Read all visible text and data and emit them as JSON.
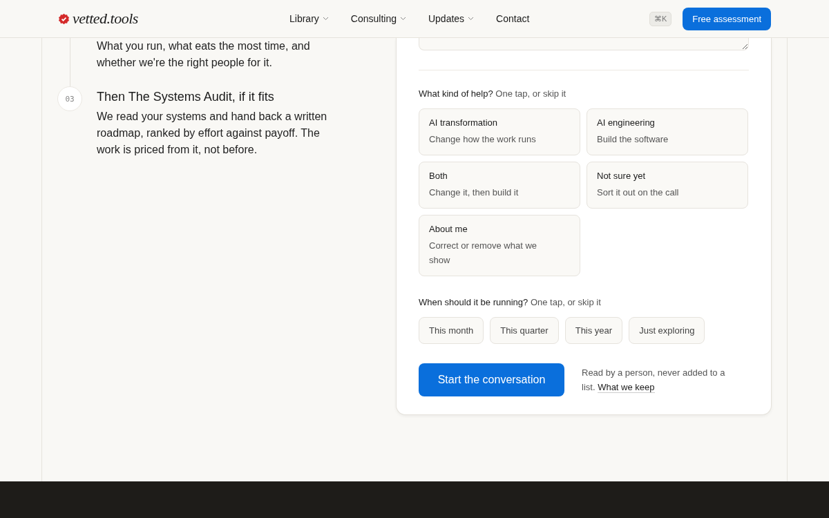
{
  "header": {
    "logo": "vetted.tools",
    "nav": [
      {
        "label": "Library",
        "dropdown": true
      },
      {
        "label": "Consulting",
        "dropdown": true
      },
      {
        "label": "Updates",
        "dropdown": true
      },
      {
        "label": "Contact",
        "dropdown": false
      }
    ],
    "shortcut": "⌘K",
    "cta": "Free assessment"
  },
  "steps": [
    {
      "text": "What you run, what eats the most time, and whether we're the right people for it."
    },
    {
      "number": "03",
      "title": "Then The Systems Audit, if it fits",
      "text": "We read your systems and hand back a written roadmap, ranked by effort against payoff. The work is priced from it, not before."
    }
  ],
  "form": {
    "help": {
      "label": "What kind of help?",
      "hint": "One tap, or skip it",
      "options": [
        {
          "title": "AI transformation",
          "subtitle": "Change how the work runs",
          "selected": false
        },
        {
          "title": "AI engineering",
          "subtitle": "Build the software",
          "selected": false
        },
        {
          "title": "Both",
          "subtitle": "Change it, then build it",
          "selected": false
        },
        {
          "title": "Not sure yet",
          "subtitle": "Sort it out on the call",
          "selected": false
        },
        {
          "title": "About me",
          "subtitle": "Correct or remove what we show",
          "selected": false
        }
      ]
    },
    "timing": {
      "label": "When should it be running?",
      "hint": "One tap, or skip it",
      "options": [
        {
          "label": "This month",
          "selected": false
        },
        {
          "label": "This quarter",
          "selected": false
        },
        {
          "label": "This year",
          "selected": false
        },
        {
          "label": "Just exploring",
          "selected": false
        }
      ]
    },
    "submit": "Start the conversation",
    "note": "Read by a person, never added to a list.",
    "note_link": "What we keep"
  }
}
